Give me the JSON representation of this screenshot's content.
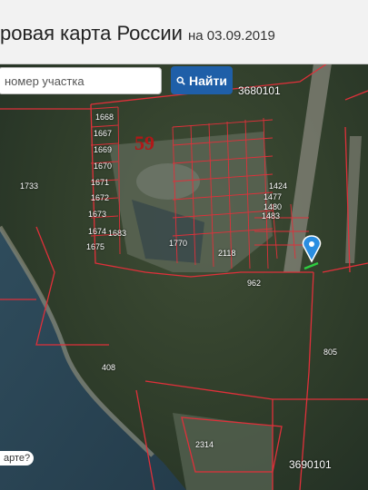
{
  "header": {
    "title": "ровая карта России",
    "date": "на 03.09.2019"
  },
  "search": {
    "placeholder": "номер участка",
    "button_label": "Найти"
  },
  "cadastral": {
    "block_top": "3680101",
    "block_bottom": "3690101",
    "big_label": "59",
    "plot_labels": [
      "1668",
      "1667",
      "1669",
      "1670",
      "1671",
      "1672",
      "1673",
      "1674",
      "1675",
      "1683",
      "1733",
      "1770",
      "962",
      "805",
      "1424",
      "1477",
      "1480",
      "1483",
      "2118",
      "2314",
      "408"
    ]
  },
  "colors": {
    "button": "#1f5fa8",
    "boundary": "#e0303a",
    "marker": "#2a8de0"
  },
  "footer": {
    "corner_text": "арте?"
  }
}
